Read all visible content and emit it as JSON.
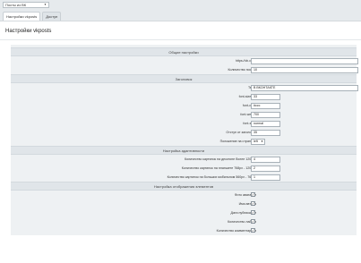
{
  "site_select": {
    "value": "Посты из ВК"
  },
  "tabs": [
    {
      "label": "Настройки vkposts"
    },
    {
      "label": "Доступ"
    }
  ],
  "page_title": "Настройки vkposts",
  "sections": {
    "general": {
      "title": "Общие настройки",
      "url_label": "https://vk.com/",
      "url_value": "",
      "posts_count_label": "Количество постов",
      "posts_count_value": "10"
    },
    "heading": {
      "title": "Заголовок",
      "text_label": "Текст",
      "text_value": "В ВКОНТАКТЕ",
      "font_size_label": "font-size, px",
      "font_size_value": "33",
      "font_color_label": "font-color",
      "font_color_value": "#ccc",
      "font_weight_label": "font-weight",
      "font_weight_value": "700",
      "font_style_label": "font-style",
      "font_style_value": "normal",
      "offset_label": "Отступ от заголовка",
      "offset_value": "35",
      "position_label": "Положение на странице",
      "position_value": "left"
    },
    "adaptive": {
      "title": "Настройка адаптивности",
      "desktop_label": "Количество картинок на десктопе более 1200px",
      "desktop_value": "4",
      "tablet_label": "Количество картинок на планшете 768px - 1200px",
      "tablet_value": "2",
      "mobile_label": "Количество картинок на больших мобильном 560px - 768px",
      "mobile_value": "1"
    },
    "display": {
      "title": "Настройка отображения элементов",
      "items": [
        {
          "label": "Фото аватарки",
          "checked": true
        },
        {
          "label": "Имя автора",
          "checked": true
        },
        {
          "label": "Дата публикации",
          "checked": true
        },
        {
          "label": "Количество лайков",
          "checked": true
        },
        {
          "label": "Количество комментариев",
          "checked": true
        }
      ]
    }
  }
}
